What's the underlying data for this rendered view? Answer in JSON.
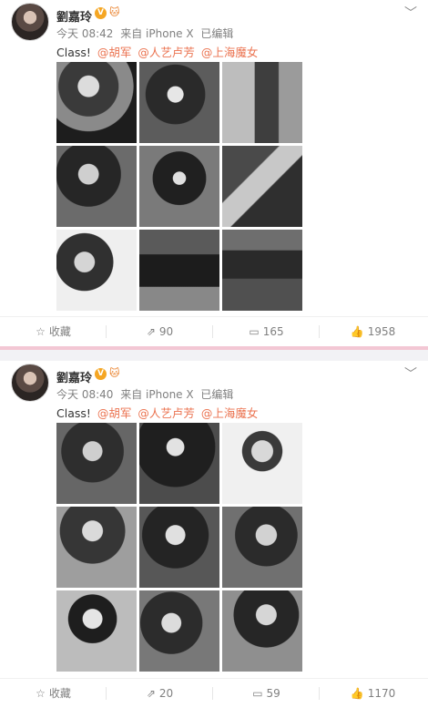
{
  "posts": [
    {
      "username": "劉嘉玲",
      "verified": "V",
      "vip_icon": "🐱",
      "time": "今天 08:42",
      "source": "来自 iPhone X",
      "edited": "已编辑",
      "text": "Class!",
      "mentions": [
        "@胡军",
        "@人艺卢芳",
        "@上海魔女"
      ],
      "actions": {
        "favorite": "收藏",
        "repost": "90",
        "comment": "165",
        "like": "1958"
      }
    },
    {
      "username": "劉嘉玲",
      "verified": "V",
      "vip_icon": "🐱",
      "time": "今天 08:40",
      "source": "来自 iPhone X",
      "edited": "已编辑",
      "text": "Class!",
      "mentions": [
        "@胡军",
        "@人艺卢芳",
        "@上海魔女"
      ],
      "actions": {
        "favorite": "收藏",
        "repost": "20",
        "comment": "59",
        "like": "1170"
      }
    }
  ],
  "icons": {
    "chevron": "chevron-down-icon",
    "favorite": "star-icon",
    "repost": "repost-icon",
    "comment": "comment-icon",
    "like": "thumbs-up-icon"
  },
  "colors": {
    "mention": "#eb7350",
    "meta": "#808080",
    "separator_pink": "#f3c7d4"
  }
}
